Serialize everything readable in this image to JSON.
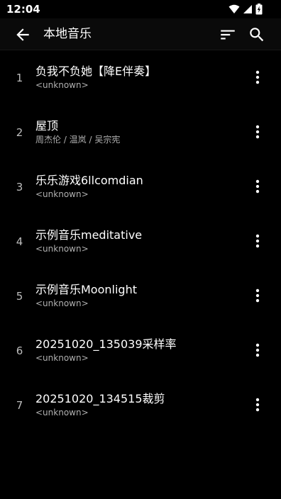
{
  "status_bar": {
    "time": "12:04"
  },
  "app_bar": {
    "title": "本地音乐"
  },
  "songs": [
    {
      "index": "1",
      "title": "负我不负她【降E伴奏】",
      "artist": "<unknown>"
    },
    {
      "index": "2",
      "title": "屋顶",
      "artist": "周杰伦 / 温岚 / 吴宗宪"
    },
    {
      "index": "3",
      "title": "乐乐游戏6llcomdian",
      "artist": "<unknown>"
    },
    {
      "index": "4",
      "title": "示例音乐meditative",
      "artist": "<unknown>"
    },
    {
      "index": "5",
      "title": "示例音乐Moonlight",
      "artist": "<unknown>"
    },
    {
      "index": "6",
      "title": "20251020_135039采样率",
      "artist": "<unknown>"
    },
    {
      "index": "7",
      "title": "20251020_134515裁剪",
      "artist": "<unknown>"
    }
  ]
}
